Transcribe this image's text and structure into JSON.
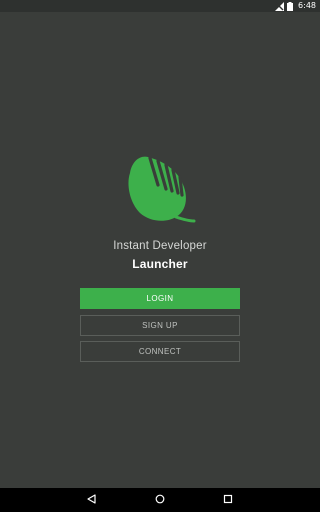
{
  "status_bar": {
    "time": "6:48",
    "icons": [
      "signal-muted-icon",
      "battery-icon"
    ]
  },
  "app": {
    "logo_icon": "leaf-logo-icon",
    "subtitle": "Instant Developer",
    "title": "Launcher",
    "accent_color": "#3db04b",
    "background_color": "#3a3d3a"
  },
  "buttons": {
    "login": "LOGIN",
    "signup": "SIGN UP",
    "connect": "CONNECT"
  },
  "nav": {
    "icons": [
      "back-icon",
      "home-icon",
      "recents-icon"
    ]
  }
}
